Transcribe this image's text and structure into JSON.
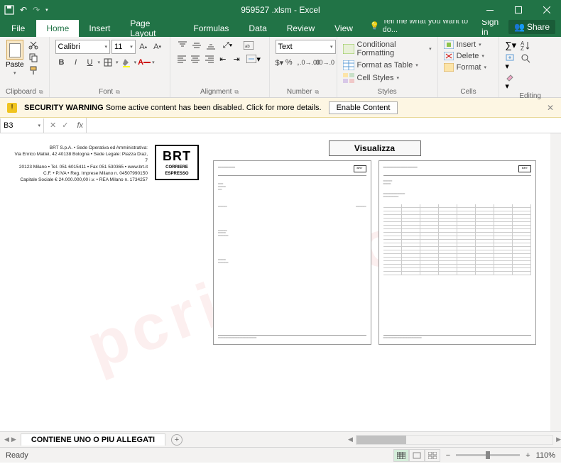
{
  "title": "959527 .xlsm - Excel",
  "signin": "Sign in",
  "share": "Share",
  "tabs": [
    "File",
    "Home",
    "Insert",
    "Page Layout",
    "Formulas",
    "Data",
    "Review",
    "View"
  ],
  "tellme": "Tell me what you want to do...",
  "ribbon": {
    "paste": "Paste",
    "clipboard": "Clipboard",
    "font_name": "Calibri",
    "font_size": "11",
    "font": "Font",
    "alignment": "Alignment",
    "number_format": "Text",
    "number": "Number",
    "cond_fmt": "Conditional Formatting",
    "fmt_table": "Format as Table",
    "cell_styles": "Cell Styles",
    "styles": "Styles",
    "insert": "Insert",
    "delete": "Delete",
    "format": "Format",
    "cells": "Cells",
    "editing": "Editing"
  },
  "security": {
    "title": "SECURITY WARNING",
    "msg": " Some active content has been disabled. Click for more details.",
    "enable": "Enable Content"
  },
  "namebox": "B3",
  "sheet": {
    "company_lines": [
      "BRT S.p.A. • Sede Operativa ed Amministrativa:",
      "Via Enrico Mattei, 42  40138 Bologna • Sede Legale: Piazza Diaz, 7",
      "20123 Milano • Tel. 051 6015411 • Fax 051 530365 • www.brt.it",
      "C.F. • P.IVA • Reg. Imprese Milano n. 04507990150",
      "Capitale Sociale € 24.000.000,00 i.v. • REA Milano n. 1734257"
    ],
    "logo_big": "BRT",
    "logo_sub1": "CORRIERE",
    "logo_sub2": "ESPRESSO",
    "visualizza": "Visualizza"
  },
  "sheettab": "CONTIENE UNO O PIU ALLEGATI",
  "status": "Ready",
  "zoom": "110%"
}
